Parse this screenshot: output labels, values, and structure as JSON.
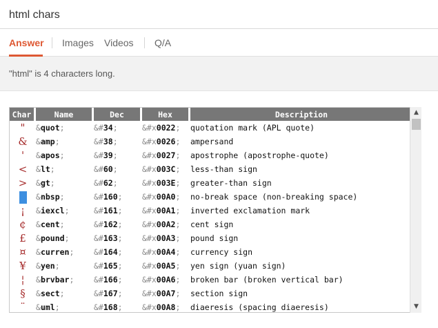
{
  "search": {
    "query": "html chars"
  },
  "tabs": [
    {
      "label": "Answer",
      "active": true
    },
    {
      "label": "Images",
      "active": false
    },
    {
      "label": "Videos",
      "active": false
    },
    {
      "label": "Q/A",
      "active": false
    }
  ],
  "answer": {
    "text": "\"html\" is 4 characters long."
  },
  "table": {
    "headers": {
      "char": "Char",
      "name": "Name",
      "dec": "Dec",
      "hex": "Hex",
      "description": "Description"
    },
    "rows": [
      {
        "char": "\"",
        "name": "quot",
        "dec": "34",
        "hex": "0022",
        "description": "quotation mark (APL quote)"
      },
      {
        "char": "&",
        "name": "amp",
        "dec": "38",
        "hex": "0026",
        "description": "ampersand"
      },
      {
        "char": "'",
        "name": "apos",
        "dec": "39",
        "hex": "0027",
        "description": "apostrophe (apostrophe-quote)"
      },
      {
        "char": "<",
        "name": "lt",
        "dec": "60",
        "hex": "003C",
        "description": "less-than sign"
      },
      {
        "char": ">",
        "name": "gt",
        "dec": "62",
        "hex": "003E",
        "description": "greater-than sign"
      },
      {
        "char": "",
        "name": "nbsp",
        "dec": "160",
        "hex": "00A0",
        "description": "no-break space (non-breaking space)",
        "swatch": true
      },
      {
        "char": "¡",
        "name": "iexcl",
        "dec": "161",
        "hex": "00A1",
        "description": "inverted exclamation mark"
      },
      {
        "char": "¢",
        "name": "cent",
        "dec": "162",
        "hex": "00A2",
        "description": "cent sign"
      },
      {
        "char": "£",
        "name": "pound",
        "dec": "163",
        "hex": "00A3",
        "description": "pound sign"
      },
      {
        "char": "¤",
        "name": "curren",
        "dec": "164",
        "hex": "00A4",
        "description": "currency sign"
      },
      {
        "char": "¥",
        "name": "yen",
        "dec": "165",
        "hex": "00A5",
        "description": "yen sign (yuan sign)"
      },
      {
        "char": "¦",
        "name": "brvbar",
        "dec": "166",
        "hex": "00A6",
        "description": "broken bar (broken vertical bar)"
      },
      {
        "char": "§",
        "name": "sect",
        "dec": "167",
        "hex": "00A7",
        "description": "section sign"
      },
      {
        "char": "¨",
        "name": "uml",
        "dec": "168",
        "hex": "00A8",
        "description": "diaeresis (spacing diaeresis)"
      }
    ]
  },
  "scrollbar": {
    "up_icon": "▲",
    "down_icon": "▼"
  },
  "colors": {
    "accent": "#de5833",
    "char_color": "#a52a2a",
    "header_bg": "#777777",
    "swatch": "#3d8fe0"
  }
}
